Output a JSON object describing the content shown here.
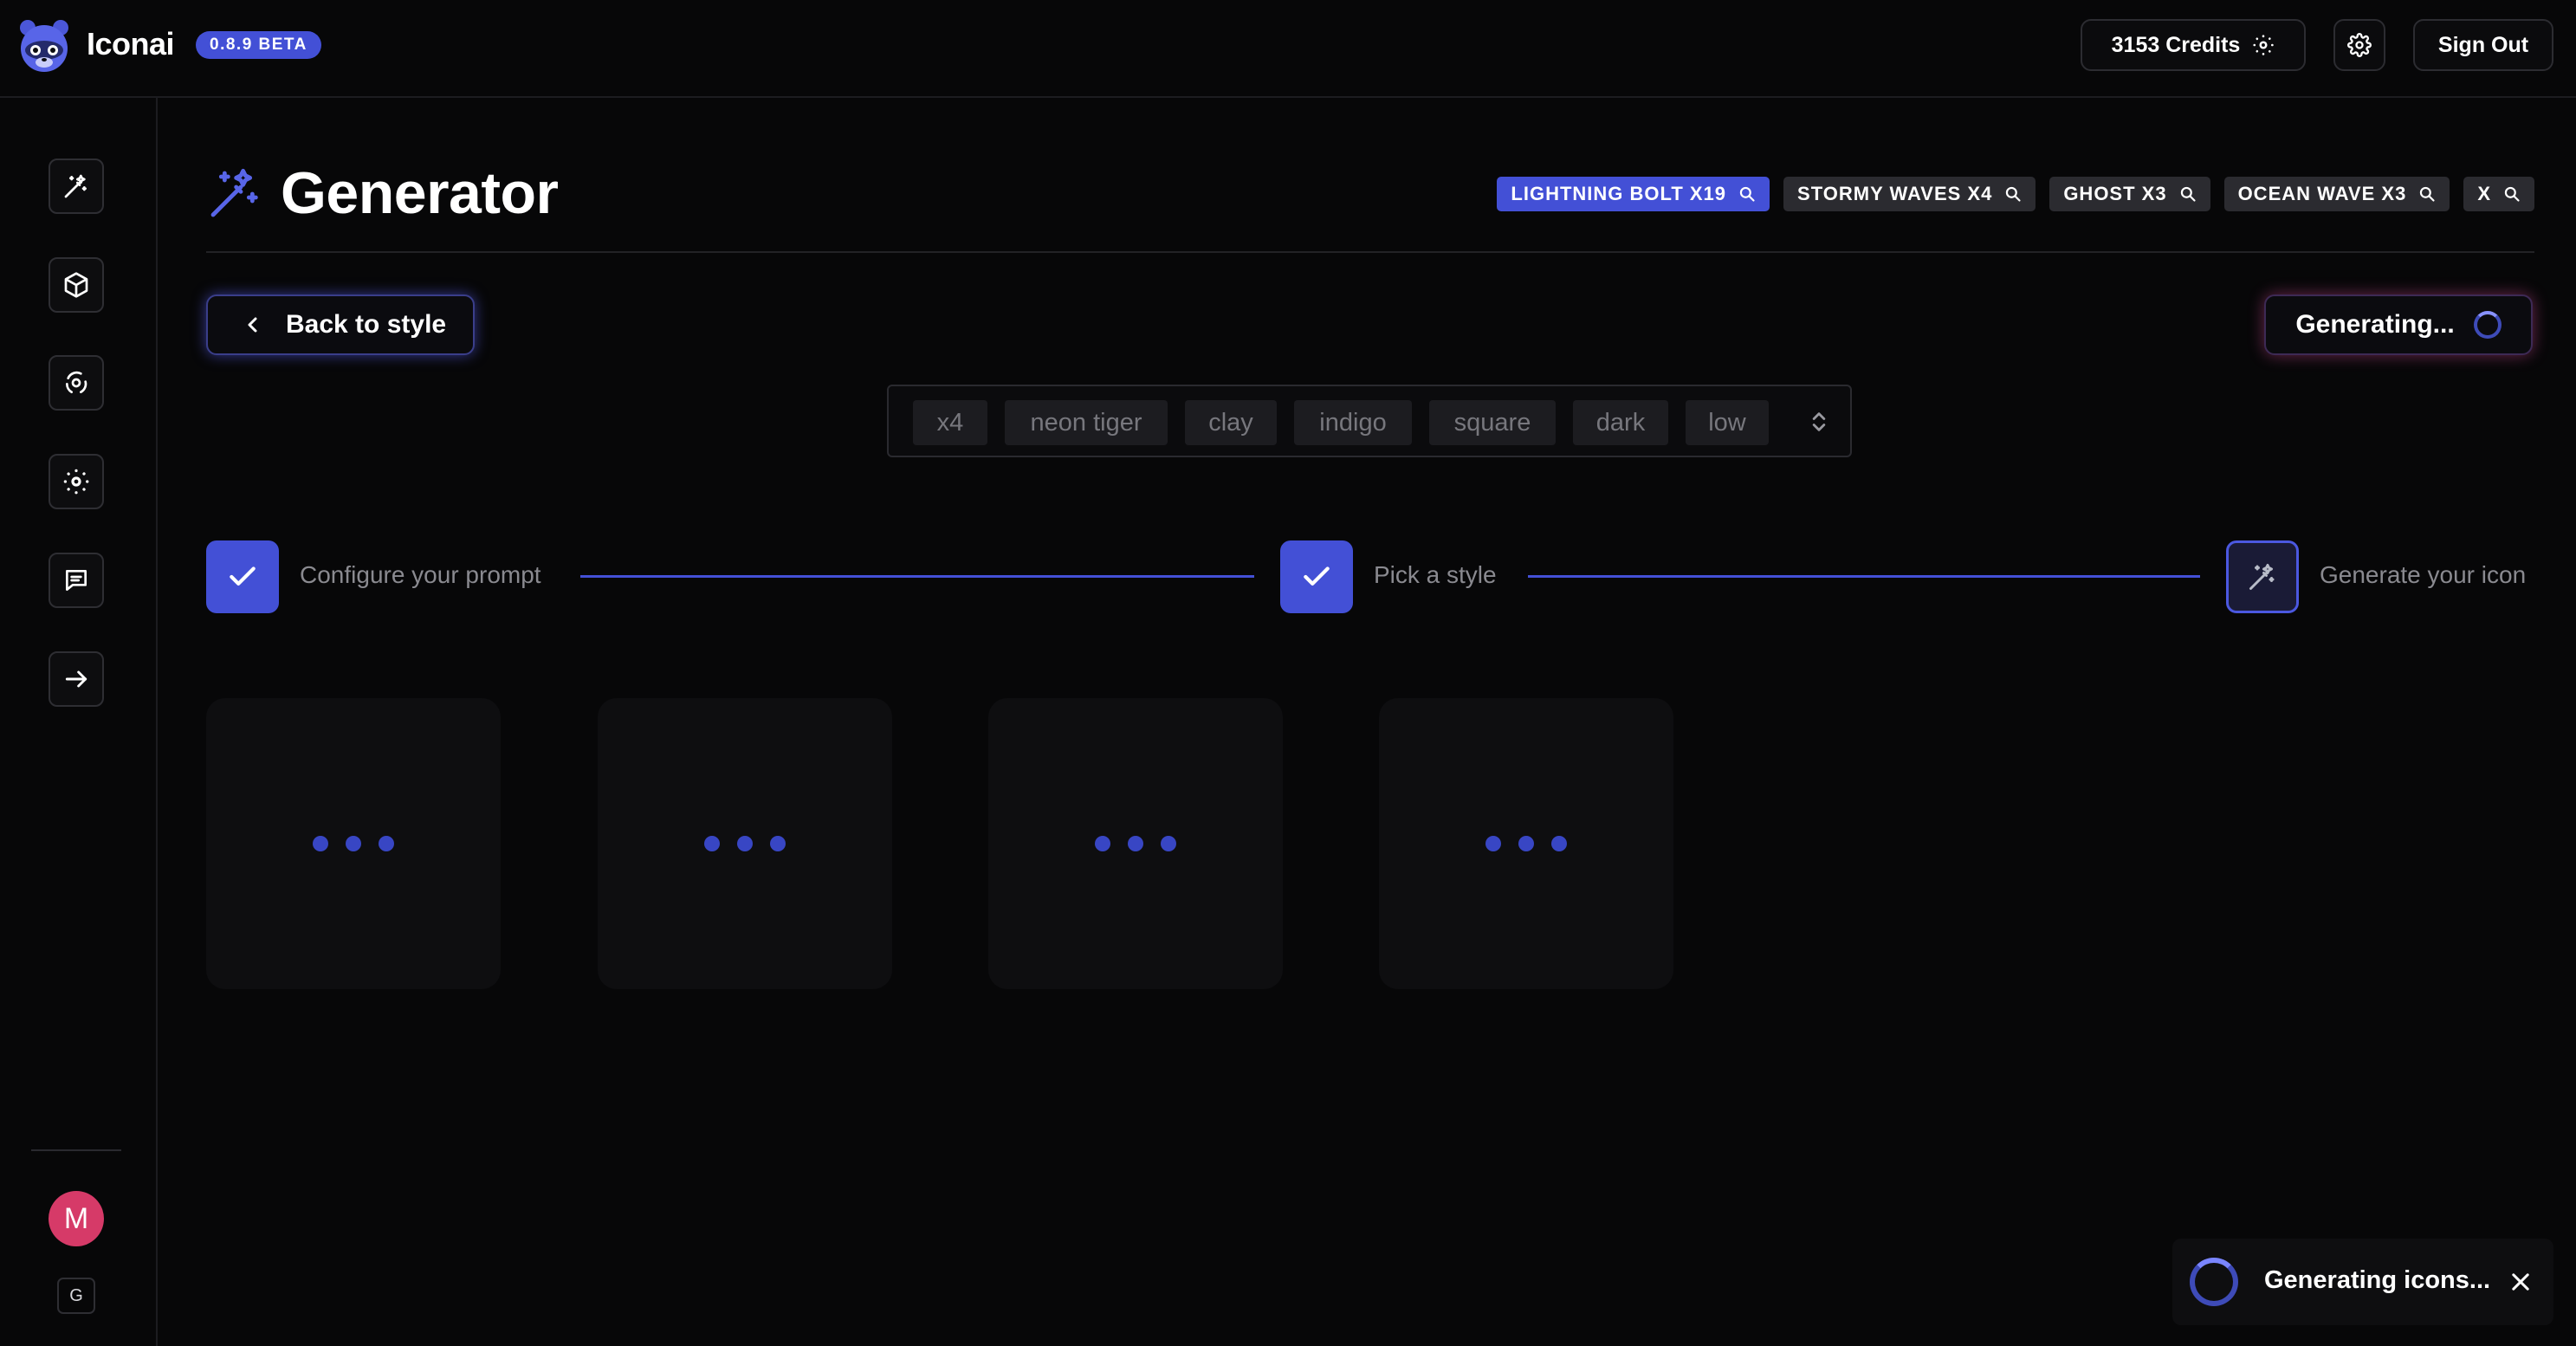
{
  "app": {
    "brand": "Iconai",
    "version": "0.8.9 BETA"
  },
  "topbar": {
    "credits_label": "3153 Credits",
    "signout_label": "Sign Out",
    "credits_icon": "credits-dots-icon",
    "settings_icon": "gear-icon"
  },
  "sidebar": {
    "items": [
      {
        "name": "generator",
        "icon": "magic-wand-icon"
      },
      {
        "name": "library",
        "icon": "cube-icon"
      },
      {
        "name": "explore",
        "icon": "orbit-icon"
      },
      {
        "name": "credits",
        "icon": "credits-dots-icon"
      },
      {
        "name": "feedback",
        "icon": "message-icon"
      },
      {
        "name": "collapse",
        "icon": "arrow-right-icon"
      }
    ],
    "avatar_initial": "M",
    "shortcut_label": "G"
  },
  "header": {
    "title": "Generator",
    "icon": "magic-wand-icon",
    "history_tags": [
      {
        "label": "LIGHTNING BOLT X19",
        "active": true
      },
      {
        "label": "STORMY WAVES X4",
        "active": false
      },
      {
        "label": "GHOST X3",
        "active": false
      },
      {
        "label": "OCEAN WAVE X3",
        "active": false
      },
      {
        "label": "X",
        "active": false
      }
    ]
  },
  "actions": {
    "back_label": "Back to style",
    "generating_label": "Generating..."
  },
  "prompt": {
    "tags": [
      "x4",
      "neon tiger",
      "clay",
      "indigo",
      "square",
      "dark",
      "low"
    ]
  },
  "stepper": {
    "steps": [
      {
        "label": "Configure your prompt",
        "status": "done"
      },
      {
        "label": "Pick a style",
        "status": "done"
      },
      {
        "label": "Generate your icon",
        "status": "current"
      }
    ]
  },
  "results": {
    "placeholder_count": 4
  },
  "toast": {
    "text": "Generating icons..."
  },
  "colors": {
    "accent": "#4350d6",
    "background": "#070708",
    "avatar": "#d63a68"
  }
}
